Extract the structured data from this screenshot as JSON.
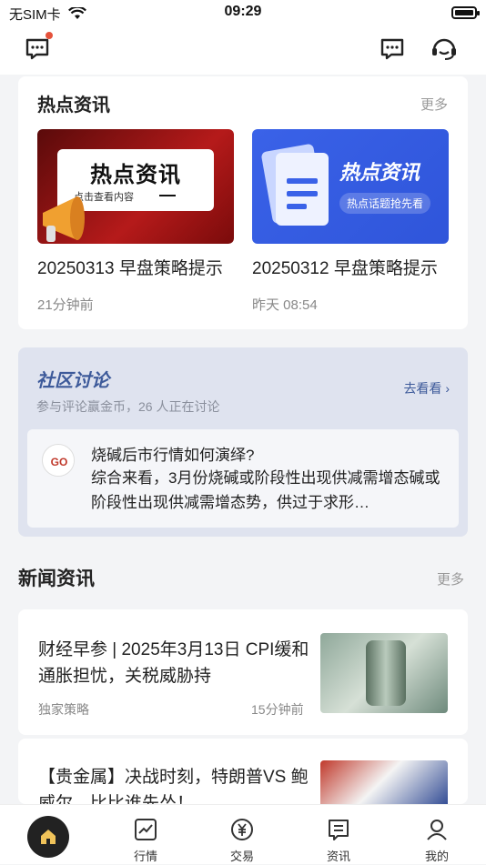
{
  "status_bar": {
    "carrier": "无SIM卡",
    "time": "09:29"
  },
  "hot_news": {
    "title": "热点资讯",
    "more": "更多",
    "items": [
      {
        "banner_text": "热点资讯",
        "banner_sub": "点击查看内容",
        "title": "20250313 早盘策略提示",
        "time": "21分钟前"
      },
      {
        "banner_text": "热点资讯",
        "banner_sub": "热点话题抢先看",
        "title": "20250312 早盘策略提示",
        "time": "昨天 08:54"
      }
    ]
  },
  "community": {
    "title": "社区讨论",
    "subtitle": "参与评论赢金币，26 人正在讨论",
    "go_label": "去看看",
    "question": "烧碱后市行情如何演绎?",
    "answer": "综合来看，3月份烧碱或阶段性出现供减需增态碱或阶段性出现供减需增态势，供过于求形…"
  },
  "news": {
    "title": "新闻资讯",
    "more": "更多",
    "items": [
      {
        "title": "财经早参 | 2025年3月13日 CPI缓和通胀担忧，关税威胁持",
        "source": "独家策略",
        "time": "15分钟前"
      },
      {
        "title": "【贵金属】决战时刻，特朗普VS 鲍威尔，比比谁先怂！",
        "source": "",
        "time": ""
      }
    ]
  },
  "tabbar": {
    "items": [
      {
        "label": ""
      },
      {
        "label": "行情"
      },
      {
        "label": "交易"
      },
      {
        "label": "资讯"
      },
      {
        "label": "我的"
      }
    ]
  },
  "colors": {
    "accent": "#3d5a9a",
    "badge": "#e5523b",
    "home_icon": "#f0c35a"
  }
}
